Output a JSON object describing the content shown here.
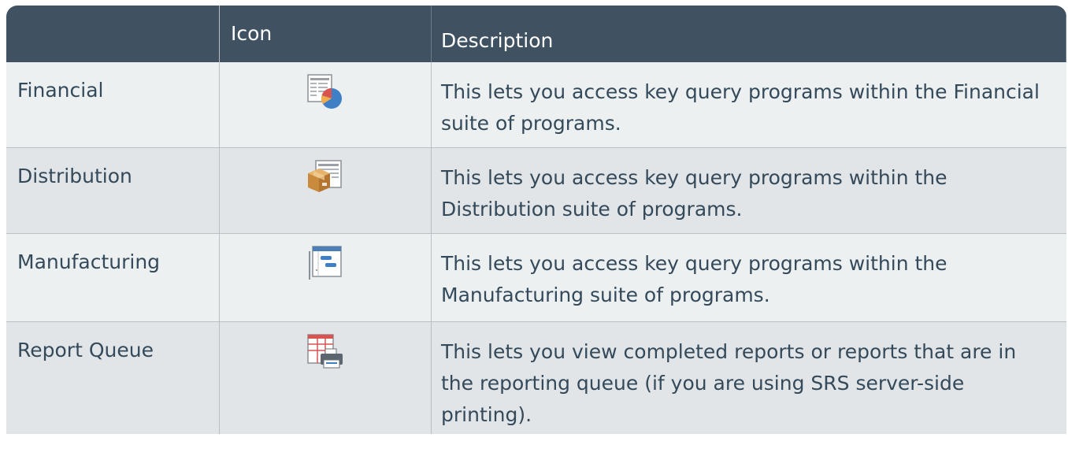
{
  "table": {
    "headers": [
      "",
      "Icon",
      "Description"
    ],
    "rows": [
      {
        "name": "Financial",
        "icon": "financial-query-icon",
        "description": "This lets you access key query programs within the Financial suite of programs."
      },
      {
        "name": "Distribution",
        "icon": "distribution-query-icon",
        "description": "This lets you access key query programs within the Distribution suite of programs."
      },
      {
        "name": "Manufacturing",
        "icon": "manufacturing-query-icon",
        "description": "This lets you access key query programs within the Manufacturing suite of programs."
      },
      {
        "name": "Report Queue",
        "icon": "report-queue-icon",
        "description": "This lets you view completed reports or reports that are in the reporting queue (if you are using SRS server-side printing)."
      }
    ]
  },
  "colors": {
    "header_bg": "#405261",
    "row_odd": "#ecf0f1",
    "row_even": "#e1e5e7",
    "text": "#34495a"
  }
}
